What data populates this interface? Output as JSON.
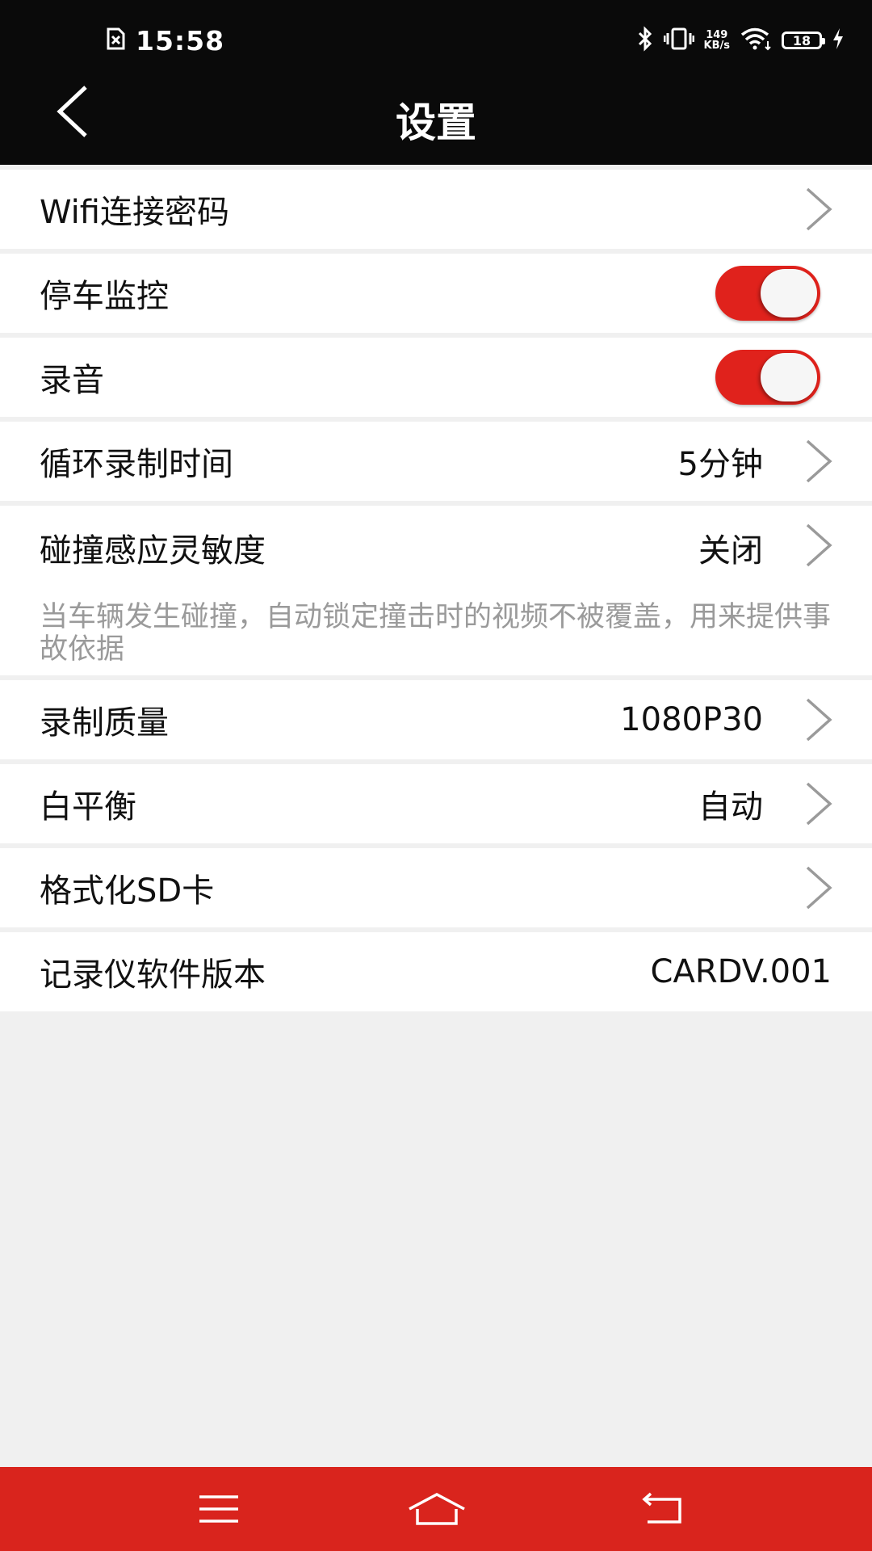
{
  "status_bar": {
    "time": "15:58",
    "net_speed_value": "149",
    "net_speed_unit": "KB/s",
    "battery_level": "18"
  },
  "header": {
    "title": "设置"
  },
  "settings": {
    "wifi_password": {
      "label": "Wifi连接密码"
    },
    "parking_monitor": {
      "label": "停车监控",
      "enabled": true
    },
    "audio_recording": {
      "label": "录音",
      "enabled": true
    },
    "loop_recording": {
      "label": "循环录制时间",
      "value": "5分钟"
    },
    "collision_sensitivity": {
      "label": "碰撞感应灵敏度",
      "value": "关闭",
      "description": "当车辆发生碰撞，自动锁定撞击时的视频不被覆盖，用来提供事故依据"
    },
    "recording_quality": {
      "label": "录制质量",
      "value": "1080P30"
    },
    "white_balance": {
      "label": "白平衡",
      "value": "自动"
    },
    "format_sd": {
      "label": "格式化SD卡"
    },
    "firmware_version": {
      "label": "记录仪软件版本",
      "value": "CARDV.001"
    }
  },
  "colors": {
    "accent": "#e0221c",
    "header_bg": "#0a0a0a",
    "page_bg": "#f0f0f0",
    "description_text": "#9a9a9a"
  },
  "icons": {
    "back": "chevron-left-icon",
    "row_arrow": "chevron-right-icon",
    "menu": "menu-icon",
    "home": "home-icon",
    "return": "return-icon"
  }
}
